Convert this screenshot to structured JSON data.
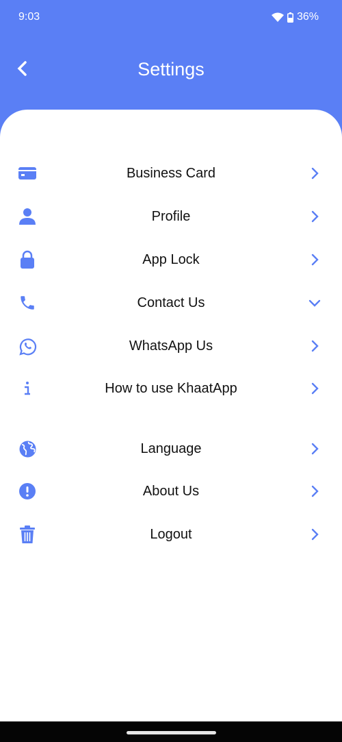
{
  "status_bar": {
    "time": "9:03",
    "battery": "36%"
  },
  "header": {
    "title": "Settings"
  },
  "theme": {
    "accent": "#5A7FF5"
  },
  "menu": [
    {
      "label": "Business Card",
      "icon": "credit-card-icon",
      "chevron": "right"
    },
    {
      "label": "Profile",
      "icon": "person-icon",
      "chevron": "right"
    },
    {
      "label": "App Lock",
      "icon": "lock-icon",
      "chevron": "right"
    },
    {
      "label": "Contact Us",
      "icon": "phone-icon",
      "chevron": "down"
    },
    {
      "label": "WhatsApp Us",
      "icon": "whatsapp-icon",
      "chevron": "right"
    },
    {
      "label": "How to use KhaatApp",
      "icon": "info-icon",
      "chevron": "right"
    },
    {
      "label": "Language",
      "icon": "globe-icon",
      "chevron": "right"
    },
    {
      "label": "About Us",
      "icon": "exclamation-circle-icon",
      "chevron": "right"
    },
    {
      "label": "Logout",
      "icon": "trash-icon",
      "chevron": "right"
    }
  ]
}
